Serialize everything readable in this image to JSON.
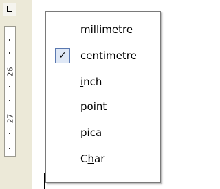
{
  "ruler": {
    "numbers": [
      "26",
      "27"
    ],
    "corner_button_icon": "tab-type-left-icon"
  },
  "menu": {
    "items": [
      {
        "pre": "",
        "access": "m",
        "post": "illimetre",
        "checked": false
      },
      {
        "pre": "",
        "access": "c",
        "post": "entimetre",
        "checked": true
      },
      {
        "pre": "",
        "access": "i",
        "post": "nch",
        "checked": false
      },
      {
        "pre": "",
        "access": "p",
        "post": "oint",
        "checked": false
      },
      {
        "pre": "pic",
        "access": "a",
        "post": "",
        "checked": false
      },
      {
        "pre": "C",
        "access": "h",
        "post": "ar",
        "checked": false
      }
    ],
    "check_glyph": "✓",
    "check_icon": "checkmark-icon"
  }
}
